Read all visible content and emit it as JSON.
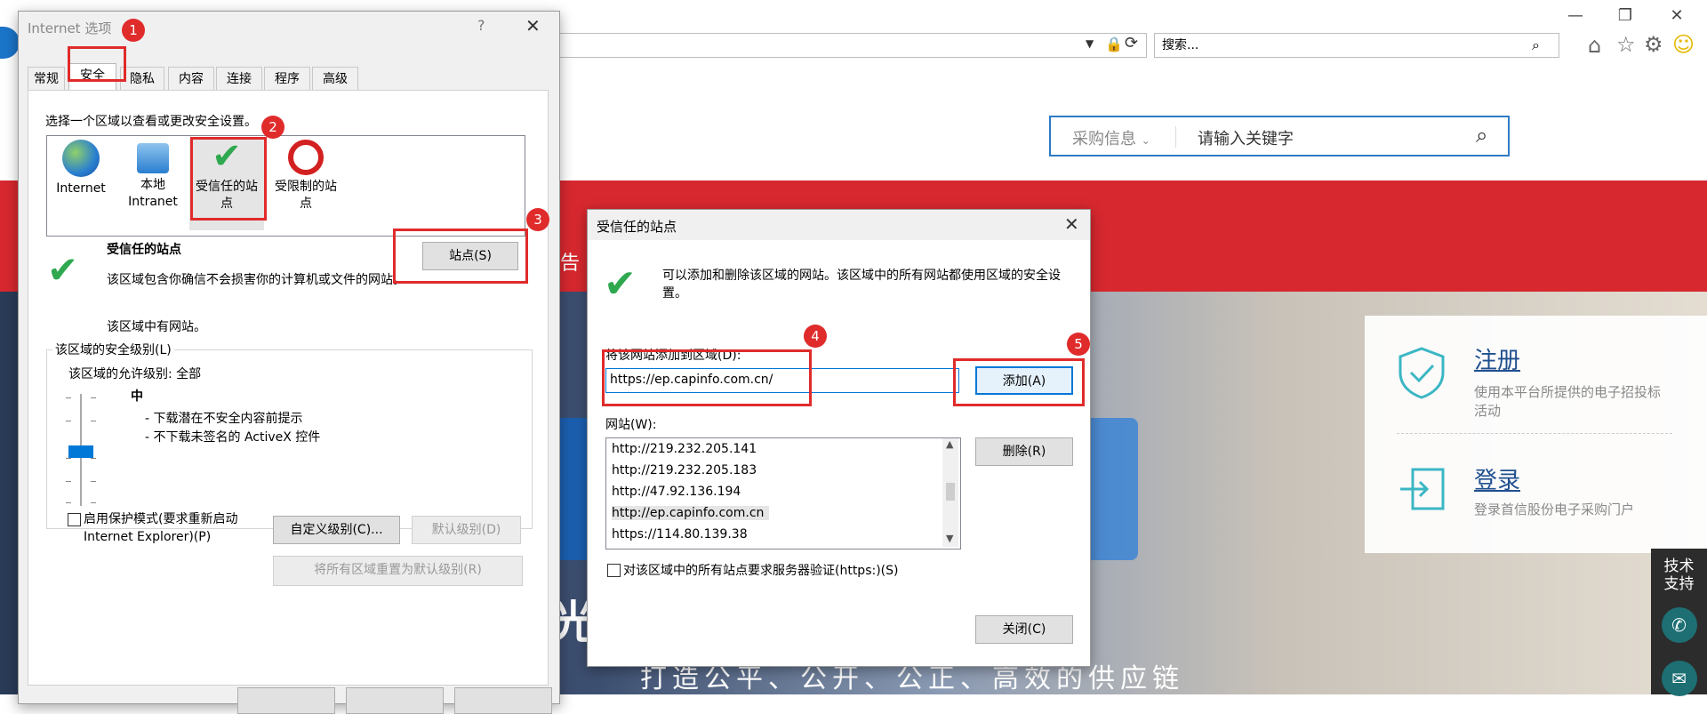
{
  "browser": {
    "search_placeholder": "搜索...",
    "win_minimize": "—",
    "win_restore": "❐",
    "win_close": "✕"
  },
  "website": {
    "search_category": "采购信息",
    "search_keyword": "请输入关键字",
    "red_menu_fragment": "告",
    "hero_title": "光  购",
    "hero_subtitle": "打造公平、公开、公正、高效的供应链",
    "register_title": "注册",
    "register_desc": "使用本平台所提供的电子招投标活动",
    "login_title": "登录",
    "login_desc": "登录首信股份电子采购门户",
    "tech_support": "技术\n支持"
  },
  "internet_options": {
    "title": "Internet 选项",
    "help": "?",
    "close": "✕",
    "tabs": [
      "常规",
      "安全",
      "隐私",
      "内容",
      "连接",
      "程序",
      "高级"
    ],
    "zone_prompt": "选择一个区域以查看或更改安全设置。",
    "zones": [
      {
        "label": "Internet"
      },
      {
        "label": "本地\nIntranet"
      },
      {
        "label": "受信任的站\n点"
      },
      {
        "label": "受限制的站\n点"
      }
    ],
    "zone_heading": "受信任的站点",
    "zone_desc": "该区域包含你确信不会损害你的计算机或文件的网站。",
    "zone_has_sites": "该区域中有网站。",
    "sites_button": "站点(S)",
    "security_level_group": "该区域的安全级别(L)",
    "allowed_level": "该区域的允许级别: 全部",
    "level_name": "中",
    "level_desc_1": "- 下载潜在不安全内容前提示",
    "level_desc_2": "- 不下载未签名的 ActiveX 控件",
    "protected_mode": "启用保护模式(要求重新启动\nInternet Explorer)(P)",
    "custom_level": "自定义级别(C)...",
    "default_level": "默认级别(D)",
    "reset_all": "将所有区域重置为默认级别(R)"
  },
  "trusted_sites": {
    "title": "受信任的站点",
    "close": "✕",
    "info": "可以添加和删除该区域的网站。该区域中的所有网站都使用区域的安全设置。",
    "add_label": "将该网站添加到区域(D):",
    "add_value": "https://ep.capinfo.com.cn/",
    "add_button": "添加(A)",
    "websites_label": "网站(W):",
    "websites": [
      "http://219.232.205.141",
      "http://219.232.205.183",
      "http://47.92.136.194",
      "http://ep.capinfo.com.cn",
      "https://114.80.139.38"
    ],
    "remove_button": "删除(R)",
    "require_https": "对该区域中的所有站点要求服务器验证(https:)(S)",
    "close_button": "关闭(C)"
  },
  "annotations": [
    "1",
    "2",
    "3",
    "4",
    "5"
  ]
}
